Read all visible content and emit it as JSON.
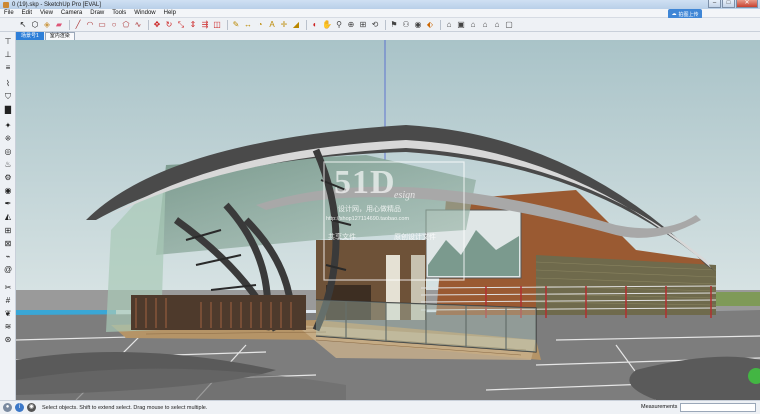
{
  "window": {
    "title": "0 (19).skp - SketchUp Pro [EVAL]"
  },
  "menu": [
    "File",
    "Edit",
    "View",
    "Camera",
    "Draw",
    "Tools",
    "Window",
    "Help"
  ],
  "cloud_badge": {
    "label": "拍图上传"
  },
  "scene_tabs": [
    {
      "label": "场景号1",
      "active": true
    },
    {
      "label": "室内渲染",
      "active": false
    }
  ],
  "watermark": {
    "logo": "51D",
    "logo_suffix": "esign",
    "line1": "设计网，用心做精品",
    "url": "http://shop127114690.taobao.com",
    "line2": "共享文件",
    "line3": "原创设计文件"
  },
  "status": {
    "hint": "Select objects. Shift to extend select. Drag mouse to select multiple.",
    "measurements_label": "Measurements",
    "measurements_value": ""
  },
  "colors": {
    "sky": "#bcd0d3",
    "ground": "#8c8c8c",
    "roof": "#4a4a4a",
    "wood": "#9a5a32",
    "accent": "#2e7fd8"
  },
  "toolbar_icons": [
    "select-arrow-icon",
    "component-icon",
    "paint-bucket-icon",
    "eraser-icon",
    "line-icon",
    "arc-icon",
    "rectangle-icon",
    "circle-icon",
    "polygon-icon",
    "freehand-icon",
    "move-icon",
    "rotate-icon",
    "scale-icon",
    "pushpull-icon",
    "followme-icon",
    "offset-icon",
    "tape-measure-icon",
    "dimension-icon",
    "protractor-icon",
    "text-icon",
    "axes-icon",
    "3d-text-icon",
    "orbit-icon",
    "pan-icon",
    "zoom-icon",
    "zoom-window-icon",
    "zoom-extents-icon",
    "previous-view-icon",
    "position-camera-icon",
    "walk-icon",
    "look-around-icon",
    "section-plane-icon",
    "iso-view-icon",
    "top-view-icon",
    "front-view-icon",
    "right-view-icon",
    "back-view-icon",
    "left-view-icon"
  ]
}
